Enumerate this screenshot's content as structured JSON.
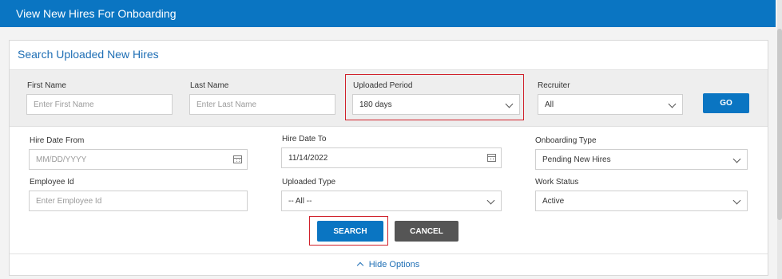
{
  "header": {
    "title": "View New Hires For Onboarding"
  },
  "panel": {
    "title": "Search Uploaded New Hires"
  },
  "basic": {
    "first_name": {
      "label": "First Name",
      "placeholder": "Enter First Name"
    },
    "last_name": {
      "label": "Last Name",
      "placeholder": "Enter Last Name"
    },
    "uploaded_period": {
      "label": "Uploaded Period",
      "value": "180 days"
    },
    "recruiter": {
      "label": "Recruiter",
      "value": "All"
    },
    "go_label": "GO"
  },
  "advanced": {
    "hire_date_from": {
      "label": "Hire Date From",
      "placeholder": "MM/DD/YYYY"
    },
    "hire_date_to": {
      "label": "Hire Date To",
      "value": "11/14/2022"
    },
    "onboarding_type": {
      "label": "Onboarding Type",
      "value": "Pending New Hires"
    },
    "employee_id": {
      "label": "Employee Id",
      "placeholder": "Enter Employee Id"
    },
    "uploaded_type": {
      "label": "Uploaded Type",
      "value": "-- All --"
    },
    "work_status": {
      "label": "Work Status",
      "value": "Active"
    }
  },
  "actions": {
    "search_label": "SEARCH",
    "cancel_label": "CANCEL"
  },
  "footer": {
    "hide_options_label": "Hide Options"
  },
  "colors": {
    "primary": "#0a75c2",
    "highlight": "#d0202a",
    "cancel": "#555555"
  }
}
